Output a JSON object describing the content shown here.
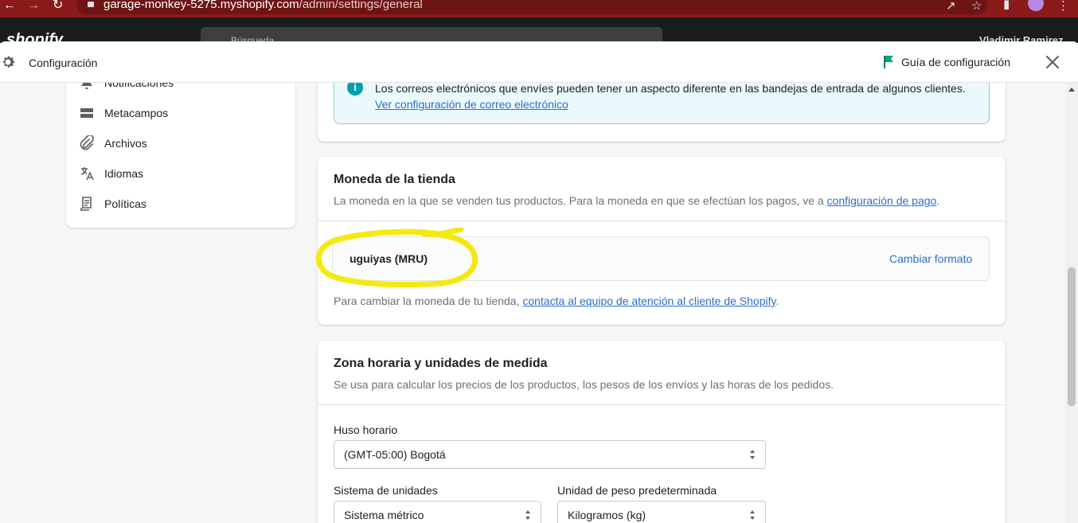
{
  "browser": {
    "url_host": "garage-monkey-5275.myshopify.com",
    "url_path": "/admin/settings/general"
  },
  "admin": {
    "logo": "shopify",
    "search_placeholder": "Búsqueda",
    "user": "Vladimir Ramirez"
  },
  "modal": {
    "title": "Configuración",
    "guide_label": "Guía de configuración"
  },
  "sidebar": {
    "items": [
      {
        "label": "Notificaciones",
        "icon": "bell-icon"
      },
      {
        "label": "Metacampos",
        "icon": "metafields-icon"
      },
      {
        "label": "Archivos",
        "icon": "paperclip-icon"
      },
      {
        "label": "Idiomas",
        "icon": "translate-icon"
      },
      {
        "label": "Políticas",
        "icon": "policy-icon"
      }
    ]
  },
  "email_banner": {
    "text": "Los correos electrónicos que envíes pueden tener un aspecto diferente en las bandejas de entrada de algunos clientes.",
    "link_part1": "Ver",
    "link_part2": "configuración de correo electrónico"
  },
  "currency": {
    "title": "Moneda de la tienda",
    "subtitle": "La moneda en la que se venden tus productos. Para la moneda en que se efectúan los pagos, ve a",
    "subtitle_link": "configuración de pago",
    "subtitle_end": ".",
    "value": "uguiyas (MRU)",
    "change_label": "Cambiar formato",
    "note": "Para cambiar la moneda de tu tienda,",
    "note_link": "contacta al equipo de atención al cliente de Shopify",
    "note_end": "."
  },
  "timezone": {
    "title": "Zona horaria y unidades de medida",
    "subtitle": "Se usa para calcular los precios de los productos, los pesos de los envíos y las horas de los pedidos.",
    "tz_label": "Huso horario",
    "tz_value": "(GMT-05:00) Bogotá",
    "units_label": "Sistema de unidades",
    "units_value": "Sistema métrico",
    "weight_label": "Unidad de peso predeterminada",
    "weight_value": "Kilogramos (kg)"
  },
  "colors": {
    "browser_bar": "#8b1a1a",
    "link": "#2c6ecb",
    "banner_bg": "#ebf9fc",
    "info_icon": "#00a0ac",
    "highlight": "#f5e911"
  }
}
